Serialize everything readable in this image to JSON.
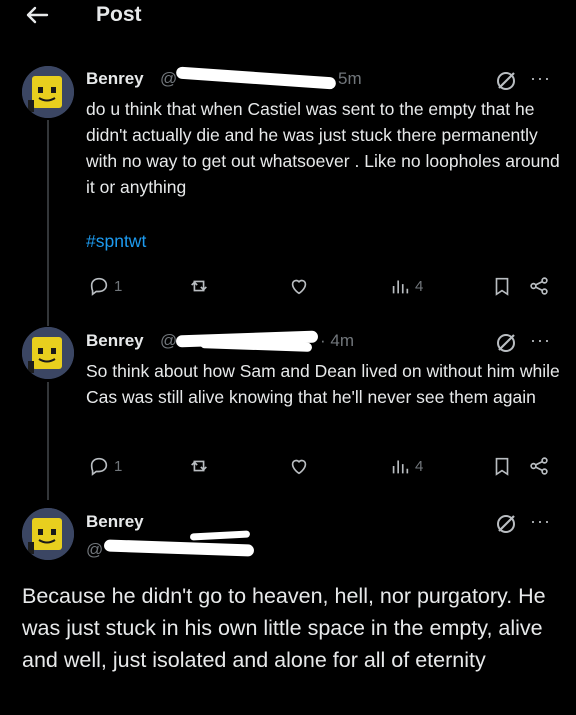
{
  "header": {
    "title": "Post"
  },
  "tweets": [
    {
      "name": "Benrey",
      "handle_prefix": "@",
      "time": "5m",
      "text": "do u think that when Castiel was sent to the empty that he didn't actually die and he was just stuck there permanently with no way to get out whatsoever . Like no loopholes around it or anything",
      "hashtag": "#spntwt",
      "replies": "1",
      "views": "4"
    },
    {
      "name": "Benrey",
      "handle_prefix": "@",
      "time": "· 4m",
      "text": "So think about how Sam and Dean lived on without him while Cas was still alive knowing that he'll never see them again",
      "replies": "1",
      "views": "4"
    },
    {
      "name": "Benrey",
      "handle_prefix": "@",
      "text": "Because he didn't go to heaven, hell, nor purgatory. He was just stuck in his own little space in the empty, alive and well, just isolated and alone for all of eternity"
    }
  ],
  "icons": [
    "back-arrow-icon",
    "grok-icon",
    "more-icon",
    "reply-icon",
    "repost-icon",
    "like-icon",
    "views-icon",
    "bookmark-icon",
    "share-icon"
  ],
  "colors": {
    "background": "#000000",
    "text": "#e7e9ea",
    "muted": "#71767b",
    "link": "#1d9bf0"
  }
}
